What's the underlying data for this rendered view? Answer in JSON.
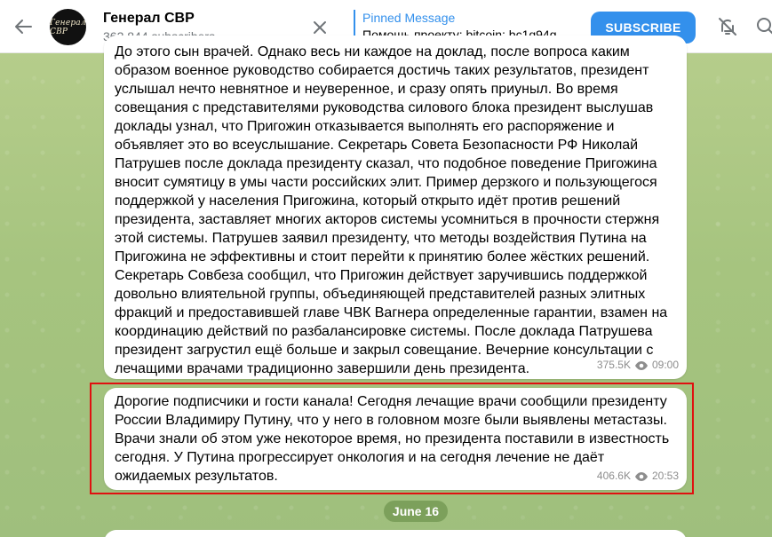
{
  "header": {
    "channel_name": "Генерал СВР",
    "subscribers": "362 844 subscribers",
    "avatar_text": "Генерал СВР",
    "pinned_title": "Pinned Message",
    "pinned_text": "Помощь проекту: bitcoin: bc1q94g...",
    "subscribe_label": "SUBSCRIBE",
    "icons": [
      "back-arrow-icon",
      "close-icon",
      "bell-off-icon",
      "search-icon"
    ]
  },
  "messages": [
    {
      "text": "До этого сын врачей. Однако весь ни каждое на доклад, после вопроса каким образом военное руководство собирается достичь таких результатов, президент услышал нечто невнятное и неуверенное, и сразу опять приуныл. Во время совещания с представителями руководства силового блока президент выслушав доклады узнал, что Пригожин отказывается выполнять его распоряжение и объявляет это во всеуслышание. Секретарь Совета Безопасности РФ Николай Патрушев после доклада президенту сказал, что подобное поведение Пригожина вносит сумятицу в умы части российских элит. Пример дерзкого и пользующегося поддержкой у населения Пригожина, который открыто идёт против решений президента, заставляет многих акторов системы усомниться в прочности стержня этой системы. Патрушев заявил президенту, что методы воздействия Путина на Пригожина не эффективны и стоит перейти к принятию более жёстких решений. Секретарь Совбеза сообщил, что Пригожин действует заручившись поддержкой довольно влиятельной группы, объединяющей представителей разных элитных фракций и предоставившей главе ЧВК Вагнера определенные гарантии, взамен на координацию действий по разбалансировке системы. После доклада Патрушева президент загрустил ещё больше и закрыл совещание. Вечерние консультации с лечащими врачами традиционно завершили день президента.",
      "views": "375.5K",
      "time": "09:00"
    },
    {
      "text": "Дорогие подписчики и гости канала! Сегодня лечащие врачи сообщили президенту России Владимиру Путину, что у него в головном мозге были выявлены метастазы. Врачи знали об этом уже некоторое время, но президента поставили в известность сегодня. У Путина прогрессирует онкология и на сегодня лечение не даёт ожидаемых результатов.",
      "views": "406.6K",
      "time": "20:53"
    }
  ],
  "date_separator": "June 16",
  "colors": {
    "accent": "#3390ec",
    "highlight": "#e01010",
    "chat_bg": "#a6c47f"
  }
}
